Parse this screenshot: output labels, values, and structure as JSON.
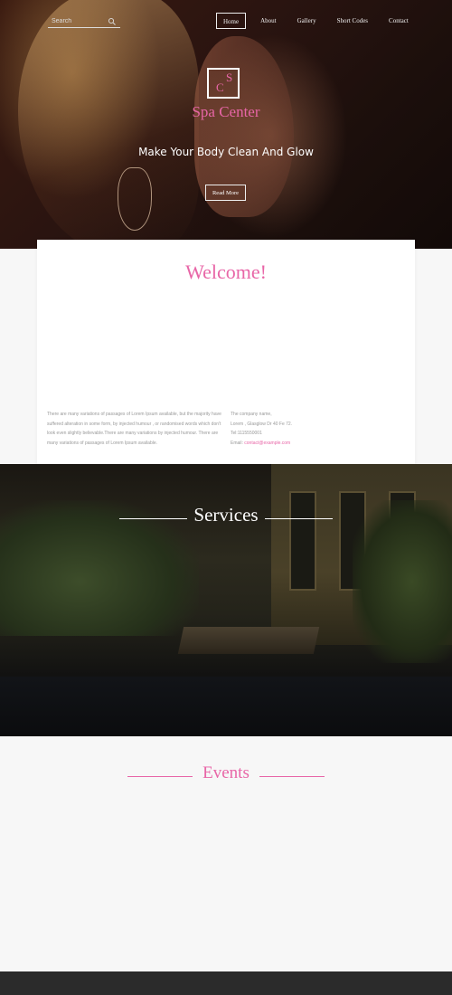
{
  "header": {
    "search": {
      "placeholder": "Search"
    },
    "nav": [
      {
        "label": "Home",
        "active": true
      },
      {
        "label": "About",
        "active": false
      },
      {
        "label": "Gallery",
        "active": false
      },
      {
        "label": "Short Codes",
        "active": false
      },
      {
        "label": "Contact",
        "active": false
      }
    ]
  },
  "hero": {
    "logo_letters": {
      "c": "C",
      "s": "S"
    },
    "logo_text": "Spa Center",
    "headline": "Make Your Body Clean And Glow",
    "cta_label": "Read More"
  },
  "welcome": {
    "title": "Welcome!",
    "body": "There are many variations of passages of Lorem Ipsum available, but the majority have suffered alteration in some form, by injected humour , or randomised words which don't look even slightly believable.There are many variations by injected humour. There are many variations of passages of Lorem Ipsum available.",
    "company": {
      "name": "The company name,",
      "address": "Lorem , Glasglow Dr 40 Fe 72.",
      "tel": "Tel:1115550001",
      "email_label": "Email: ",
      "email": "contact@example.com"
    }
  },
  "services": {
    "title": "Services"
  },
  "events": {
    "title": "Events"
  },
  "colors": {
    "accent": "#e866a7",
    "footer": "#2b2b2b"
  }
}
